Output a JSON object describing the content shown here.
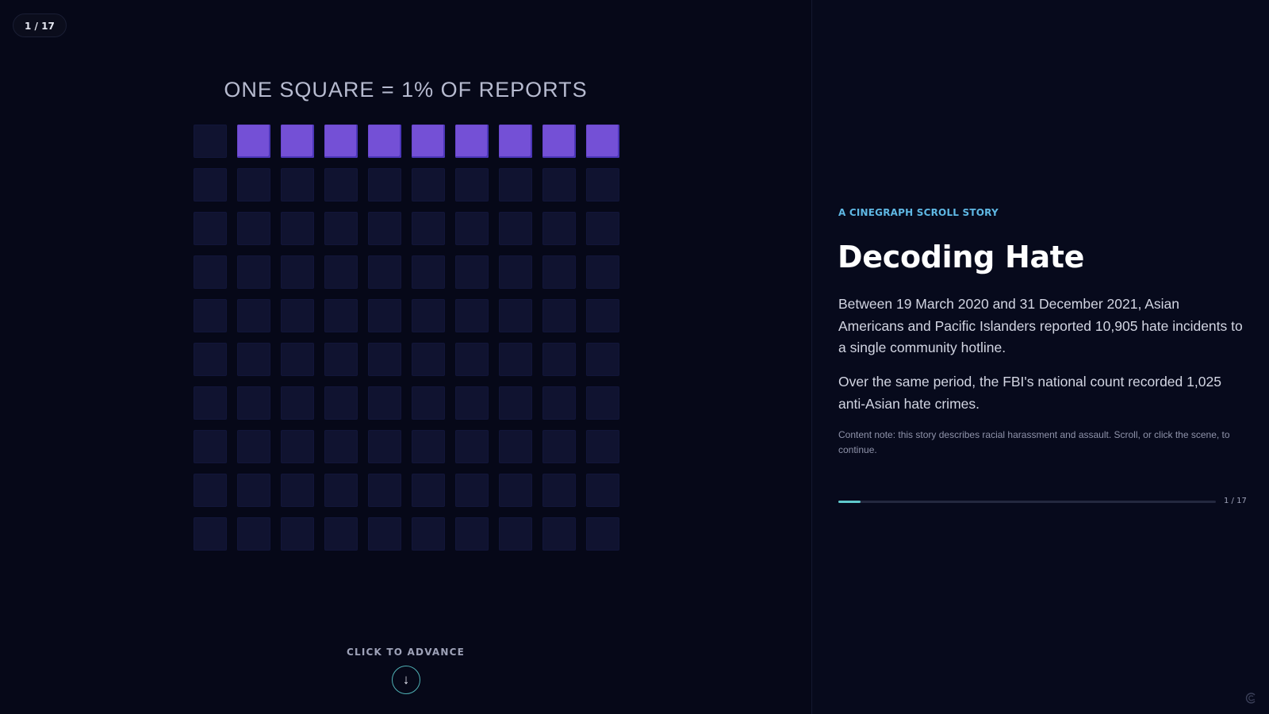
{
  "scene": {
    "counter": "1 / 17",
    "grid_title": "ONE SQUARE = 1% OF REPORTS",
    "advance_label": "CLICK TO ADVANCE",
    "advance_icon": "arrow-down-icon",
    "accent_color": "#7450d6"
  },
  "chart_data": {
    "type": "waffle",
    "total_squares": 100,
    "columns": 10,
    "rows": 10,
    "filled_squares": 9,
    "filled_color": "#7450d6",
    "empty_color": "#101330",
    "title": "ONE SQUARE = 1% OF REPORTS"
  },
  "panel": {
    "kicker": "A CINEGRAPH SCROLL STORY",
    "headline": "Decoding Hate",
    "paragraph_1": "Between 19 March 2020 and 31 December 2021, Asian Americans and Pacific Islanders reported 10,905 hate incidents to a single community hotline.",
    "paragraph_2": "Over the same period, the FBI's national count recorded 1,025 anti-Asian hate crimes.",
    "content_note": "Content note: this story describes racial harassment and assault. Scroll, or click the scene, to continue.",
    "progress": {
      "current": 1,
      "total": 17,
      "label": "1 / 17",
      "color": "#5fc9cc"
    },
    "kicker_color": "#5fb8e4"
  }
}
